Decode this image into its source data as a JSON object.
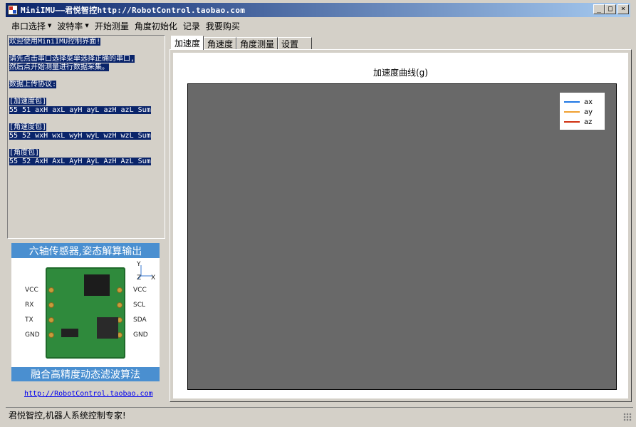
{
  "window": {
    "title": "MiniIMU——君悦智控http://RobotControl.taobao.com",
    "controls": {
      "minimize": "_",
      "maximize": "□",
      "close": "×"
    }
  },
  "menu": {
    "items": [
      {
        "label": "串口选择",
        "dropdown": true
      },
      {
        "label": "波特率",
        "dropdown": true
      },
      {
        "label": "开始测量",
        "dropdown": false
      },
      {
        "label": "角度初始化",
        "dropdown": false
      },
      {
        "label": "记录",
        "dropdown": false
      },
      {
        "label": "我要购买",
        "dropdown": false
      }
    ]
  },
  "info": {
    "welcome": "欢迎使用MiniIMU控制界面!",
    "instruction_line1": "请先点击串口选择菜单选择正确的串口,",
    "instruction_line2": "然后点开始测量进行数据采集。",
    "protocol_title": "数据上传协议:",
    "accel_header": "[加速度包]",
    "accel_bytes": "55 51 axH axL ayH ayL azH azL Sum",
    "gyro_header": "[角速度包]",
    "gyro_bytes": "55 52 wxH wxL wyH wyL wzH wzL Sum",
    "angle_header": "[角度包]",
    "angle_bytes": "55 52 AxH AxL AyH AyL AzH AzL Sum"
  },
  "product": {
    "banner_top": "六轴传感器,姿态解算输出",
    "banner_bottom": "融合高精度动态滤波算法",
    "pins_left": [
      "VCC",
      "RX",
      "TX",
      "GND"
    ],
    "pins_right": [
      "VCC",
      "SCL",
      "SDA",
      "GND"
    ],
    "axis_labels": {
      "y": "Y",
      "z": "Z",
      "x": "X"
    },
    "link": "http://RobotControl.taobao.com"
  },
  "tabs": [
    {
      "label": "加速度",
      "active": true
    },
    {
      "label": "角速度",
      "active": false
    },
    {
      "label": "角度测量",
      "active": false
    },
    {
      "label": "设置",
      "active": false
    }
  ],
  "chart_data": {
    "type": "line",
    "title": "加速度曲线(g)",
    "series": [
      {
        "name": "ax",
        "color": "#1f77e4",
        "values": []
      },
      {
        "name": "ay",
        "color": "#f0a030",
        "values": []
      },
      {
        "name": "az",
        "color": "#d03010",
        "values": []
      }
    ],
    "plot_background": "#696969",
    "legend_position": "top-right",
    "grid": false
  },
  "status": {
    "text": "君悦智控,机器人系统控制专家!"
  }
}
